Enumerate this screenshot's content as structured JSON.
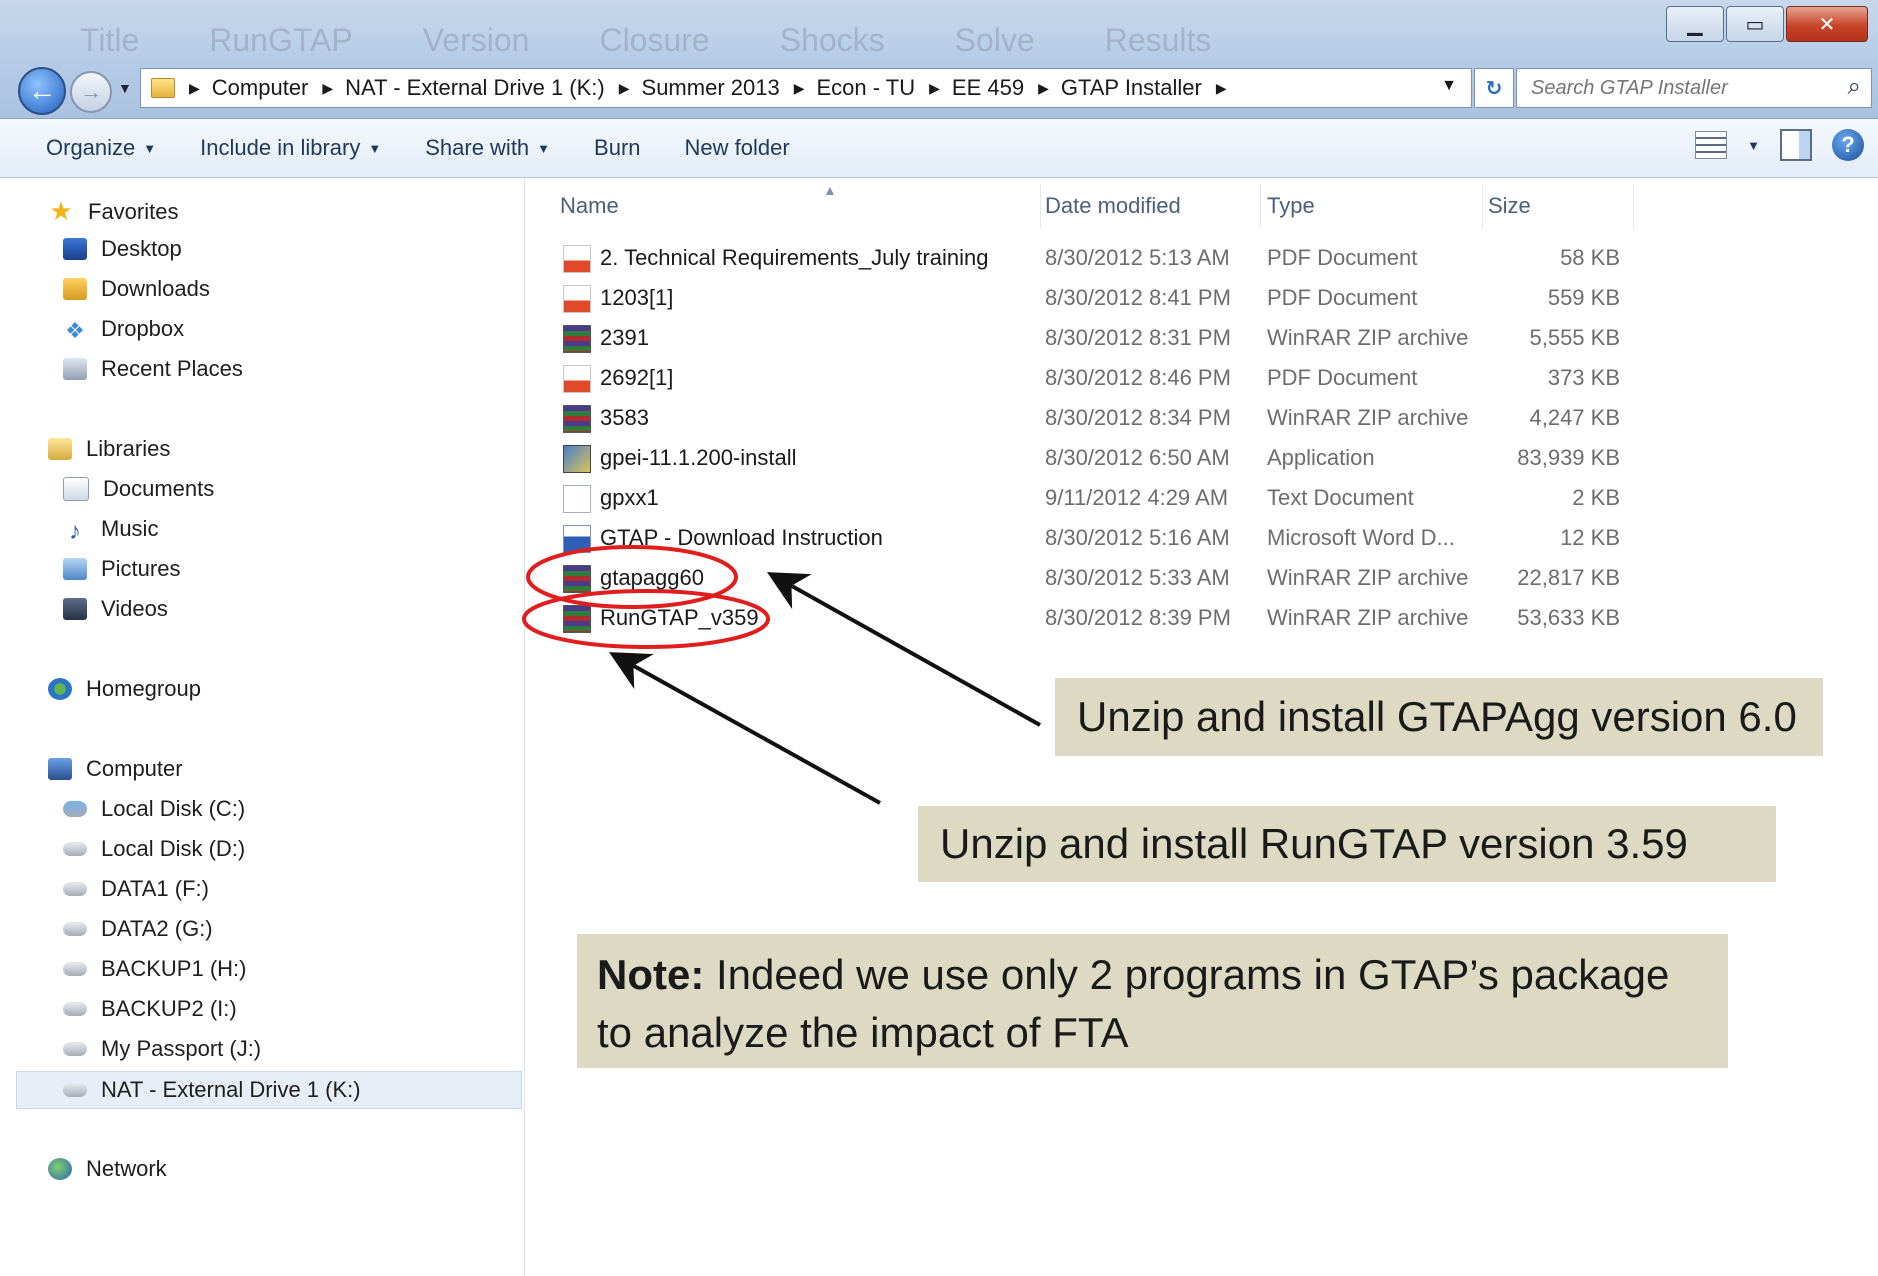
{
  "window": {
    "ghost_tabs": [
      "Title",
      "RunGTAP",
      "Version",
      "Closure",
      "Shocks",
      "Solve",
      "Results"
    ]
  },
  "address": {
    "crumbs": [
      "Computer",
      "NAT - External Drive 1  (K:)",
      "Summer 2013",
      "Econ - TU",
      "EE 459",
      "GTAP Installer"
    ]
  },
  "search": {
    "placeholder": "Search GTAP Installer"
  },
  "toolbar": {
    "organize": "Organize",
    "include_in_library": "Include in library",
    "share_with": "Share with",
    "burn": "Burn",
    "new_folder": "New folder"
  },
  "nav": {
    "favorites": "Favorites",
    "desktop": "Desktop",
    "downloads": "Downloads",
    "dropbox": "Dropbox",
    "recent_places": "Recent Places",
    "libraries": "Libraries",
    "documents": "Documents",
    "music": "Music",
    "pictures": "Pictures",
    "videos": "Videos",
    "homegroup": "Homegroup",
    "computer": "Computer",
    "drives": [
      "Local Disk (C:)",
      "Local Disk (D:)",
      "DATA1 (F:)",
      "DATA2 (G:)",
      "BACKUP1 (H:)",
      "BACKUP2 (I:)",
      "My Passport (J:)",
      "NAT - External Drive 1  (K:)"
    ],
    "network": "Network"
  },
  "columns": {
    "name": "Name",
    "date": "Date modified",
    "type": "Type",
    "size": "Size"
  },
  "files": [
    {
      "name": "2. Technical Requirements_July training",
      "date": "8/30/2012 5:13 AM",
      "type": "PDF Document",
      "size": "58 KB",
      "icon": "pdf"
    },
    {
      "name": "1203[1]",
      "date": "8/30/2012 8:41 PM",
      "type": "PDF Document",
      "size": "559 KB",
      "icon": "pdf"
    },
    {
      "name": "2391",
      "date": "8/30/2012 8:31 PM",
      "type": "WinRAR ZIP archive",
      "size": "5,555 KB",
      "icon": "zip"
    },
    {
      "name": "2692[1]",
      "date": "8/30/2012 8:46 PM",
      "type": "PDF Document",
      "size": "373 KB",
      "icon": "pdf"
    },
    {
      "name": "3583",
      "date": "8/30/2012 8:34 PM",
      "type": "WinRAR ZIP archive",
      "size": "4,247 KB",
      "icon": "zip"
    },
    {
      "name": "gpei-11.1.200-install",
      "date": "8/30/2012 6:50 AM",
      "type": "Application",
      "size": "83,939 KB",
      "icon": "app"
    },
    {
      "name": "gpxx1",
      "date": "9/11/2012 4:29 AM",
      "type": "Text Document",
      "size": "2 KB",
      "icon": "txt"
    },
    {
      "name": "GTAP - Download Instruction",
      "date": "8/30/2012 5:16 AM",
      "type": "Microsoft Word D...",
      "size": "12 KB",
      "icon": "word"
    },
    {
      "name": "gtapagg60",
      "date": "8/30/2012 5:33 AM",
      "type": "WinRAR ZIP archive",
      "size": "22,817 KB",
      "icon": "zip"
    },
    {
      "name": "RunGTAP_v359",
      "date": "8/30/2012 8:39 PM",
      "type": "WinRAR ZIP archive",
      "size": "53,633 KB",
      "icon": "zip"
    }
  ],
  "annotations": {
    "callout1": "Unzip and install GTAPAgg version 6.0",
    "callout2": "Unzip and install RunGTAP version 3.59",
    "note_label": "Note:",
    "note_text": " Indeed we use only 2 programs in GTAP’s package to analyze the impact of FTA",
    "highlight_color": "#e01e1e",
    "callout_bg": "#ddd9c3"
  }
}
